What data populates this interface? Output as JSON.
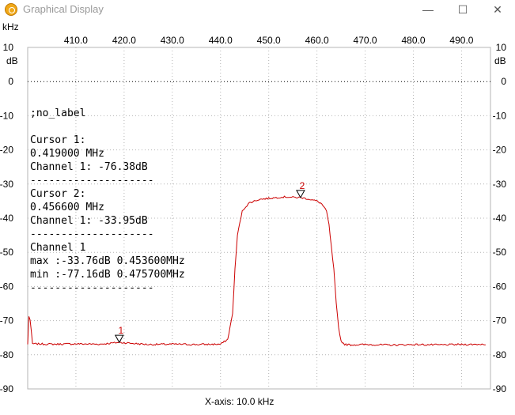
{
  "window": {
    "title": "Graphical Display",
    "minimize_glyph": "—",
    "maximize_glyph": "☐",
    "close_glyph": "✕",
    "icon": "app-icon"
  },
  "axes": {
    "x_unit_top": "kHz",
    "y_unit": "dB",
    "x_ticks_labeled": [
      "410.0",
      "420.0",
      "430.0",
      "440.0",
      "450.0",
      "460.0",
      "470.0",
      "480.0",
      "490.0"
    ],
    "y_ticks": [
      "10",
      "0",
      "-10",
      "-20",
      "-30",
      "-40",
      "-50",
      "-60",
      "-70",
      "-80",
      "-90"
    ],
    "x_axis_caption": "X-axis: 10.0 kHz"
  },
  "overlay": {
    "label": ";no_label",
    "lines": [
      "Cursor 1:",
      "0.419000 MHz",
      "Channel 1: -76.38dB",
      "--------------------",
      "Cursor 2:",
      "0.456600 MHz",
      "Channel 1: -33.95dB",
      "--------------------",
      "Channel 1",
      "max :-33.76dB 0.453600MHz",
      "min :-77.16dB 0.475700MHz",
      "--------------------"
    ]
  },
  "cursors": [
    {
      "label": "1",
      "x_khz": 419.0,
      "y_db": -76.38
    },
    {
      "label": "2",
      "x_khz": 456.6,
      "y_db": -33.95
    }
  ],
  "colors": {
    "trace": "#cc0000",
    "grid": "#b4b4b4",
    "background": "#ffffff"
  },
  "chart_data": {
    "type": "line",
    "x_unit": "kHz",
    "y_unit": "dB",
    "xlim": [
      400.0,
      496.0
    ],
    "ylim": [
      -90,
      10
    ],
    "series": [
      {
        "x": [
          400.0,
          400.3,
          401,
          405,
          410,
          415,
          419.0,
          425,
          430,
          435,
          440,
          441.5,
          442.5,
          443.0,
          443.5,
          444.5,
          445.0,
          446.0,
          448,
          450,
          452,
          453.6,
          455,
          456.6,
          458,
          460,
          461,
          462,
          462.5,
          463.5,
          464.0,
          464.5,
          465.0,
          465.8,
          467,
          470,
          475.7,
          480,
          485,
          490,
          495
        ],
        "y": [
          -77.0,
          -67.0,
          -76.8,
          -76.9,
          -76.8,
          -76.9,
          -76.38,
          -77.0,
          -76.9,
          -77.0,
          -76.9,
          -75.5,
          -68.0,
          -55.0,
          -45.0,
          -38.0,
          -37.0,
          -35.5,
          -34.5,
          -34.2,
          -33.9,
          -33.76,
          -33.9,
          -33.95,
          -34.3,
          -35.0,
          -35.8,
          -38.0,
          -42.0,
          -55.0,
          -65.0,
          -72.0,
          -76.0,
          -77.0,
          -77.1,
          -77.0,
          -77.16,
          -77.0,
          -77.1,
          -77.0,
          -76.9
        ]
      }
    ]
  }
}
